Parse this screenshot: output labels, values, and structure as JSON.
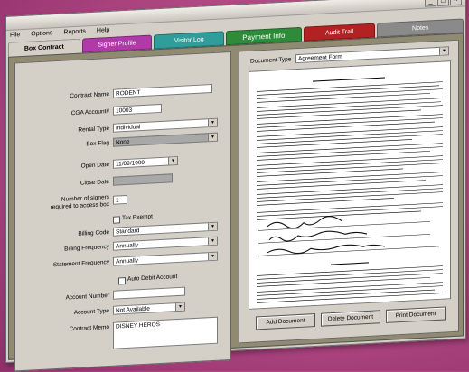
{
  "window": {
    "controls": [
      "_",
      "□",
      "×"
    ]
  },
  "menu": [
    "File",
    "Options",
    "Reports",
    "Help"
  ],
  "tabs": [
    {
      "label": "Box Contract",
      "color": "#d4d0c8"
    },
    {
      "label": "Signer Profile",
      "color": "#b03aa8"
    },
    {
      "label": "Visitor Log",
      "color": "#2f9e9a"
    },
    {
      "label": "Payment Info",
      "color": "#2e8b3a"
    },
    {
      "label": "Audit Trail",
      "color": "#b32222"
    },
    {
      "label": "Notes",
      "color": "#8a8a8a"
    }
  ],
  "form": {
    "contract_name_label": "Contract Name",
    "contract_name": "RODENT",
    "cga_account_label": "CGA Account#",
    "cga_account": "10003",
    "rental_type_label": "Rental Type",
    "rental_type": "Individual",
    "box_flag_label": "Box Flag",
    "box_flag": "None",
    "open_date_label": "Open Date",
    "open_date": "11/09/1999",
    "close_date_label": "Close Date",
    "close_date": "",
    "signers_label_1": "Number of signers",
    "signers_label_2": "required to access box",
    "signers": "1",
    "tax_exempt_label": "Tax Exempt",
    "billing_code_label": "Billing Code",
    "billing_code": "Standard",
    "billing_frequency_label": "Billing Frequency",
    "billing_frequency": "Annually",
    "statement_frequency_label": "Statement Frequency",
    "statement_frequency": "Annually",
    "auto_debit_label": "Auto Debit Account",
    "account_number_label": "Account Number",
    "account_number": "",
    "account_type_label": "Account Type",
    "account_type": "Not Available",
    "contract_memo_label": "Contract Memo",
    "contract_memo": "DISNEY HEROS"
  },
  "document": {
    "type_label": "Document Type",
    "type_value": "Agreement Form",
    "buttons": {
      "add": "Add Document",
      "delete": "Delete Document",
      "print": "Print Document"
    }
  }
}
